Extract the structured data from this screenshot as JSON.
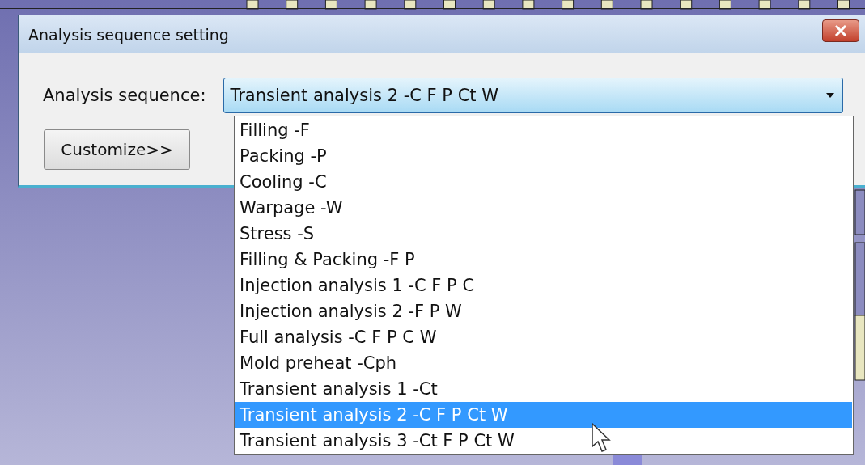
{
  "window": {
    "title": "Analysis sequence setting"
  },
  "sequence": {
    "label": "Analysis sequence:",
    "value": "Transient analysis 2 -C F P Ct W",
    "expanded": true
  },
  "options": [
    {
      "label": "Filling -F",
      "selected": false
    },
    {
      "label": "Packing -P",
      "selected": false
    },
    {
      "label": "Cooling -C",
      "selected": false
    },
    {
      "label": "Warpage -W",
      "selected": false
    },
    {
      "label": "Stress -S",
      "selected": false
    },
    {
      "label": "Filling & Packing -F P",
      "selected": false
    },
    {
      "label": "Injection analysis 1 -C F P C",
      "selected": false
    },
    {
      "label": "Injection analysis 2 -F P W",
      "selected": false
    },
    {
      "label": "Full analysis -C F P C W",
      "selected": false
    },
    {
      "label": "Mold preheat -Cph",
      "selected": false
    },
    {
      "label": "Transient analysis 1 -Ct",
      "selected": false
    },
    {
      "label": "Transient analysis 2 -C F P Ct W",
      "selected": true
    },
    {
      "label": "Transient analysis 3 -Ct F P Ct W",
      "selected": false
    }
  ],
  "buttons": [
    {
      "label": "Customize>>"
    }
  ]
}
